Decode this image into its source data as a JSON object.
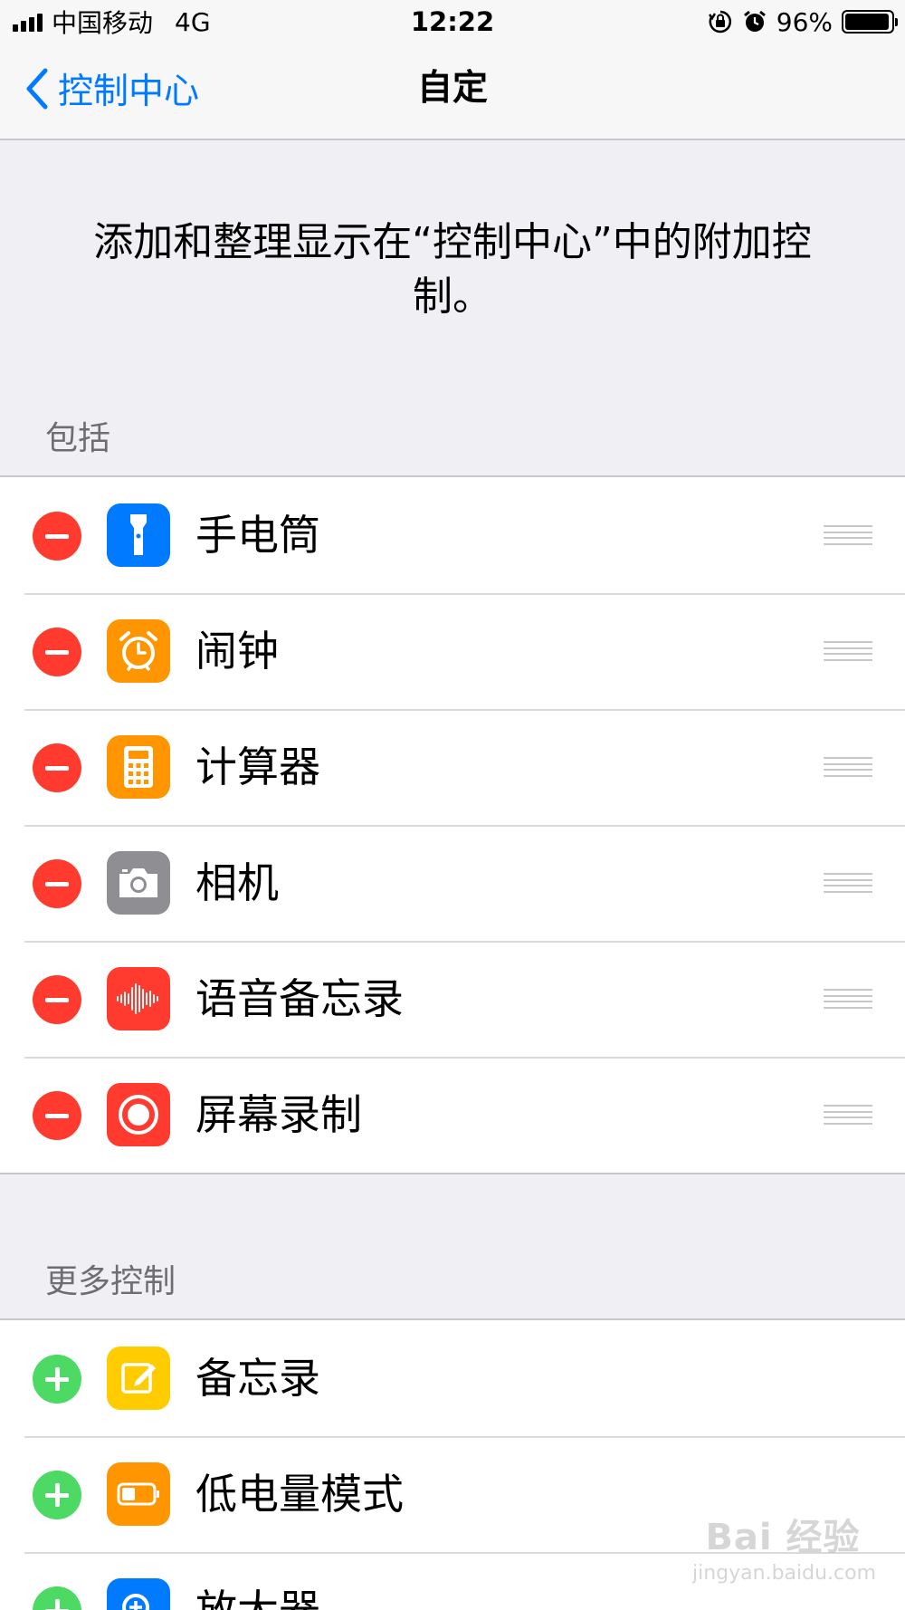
{
  "status_bar": {
    "carrier": "中国移动",
    "network": "4G",
    "time": "12:22",
    "battery_percent": "96%",
    "battery_level": 0.96
  },
  "nav": {
    "back_label": "控制中心",
    "title": "自定"
  },
  "description": "添加和整理显示在“控制中心”中的附加控制。",
  "included": {
    "header": "包括",
    "items": [
      {
        "label": "手电筒",
        "icon": "flashlight-icon",
        "color": "#007aff"
      },
      {
        "label": "闹钟",
        "icon": "alarm-clock-icon",
        "color": "#ff9500"
      },
      {
        "label": "计算器",
        "icon": "calculator-icon",
        "color": "#ff9500"
      },
      {
        "label": "相机",
        "icon": "camera-icon",
        "color": "#8e8e93"
      },
      {
        "label": "语音备忘录",
        "icon": "voice-memo-icon",
        "color": "#ff3b30"
      },
      {
        "label": "屏幕录制",
        "icon": "screen-record-icon",
        "color": "#ff3b30"
      }
    ]
  },
  "more": {
    "header": "更多控制",
    "items": [
      {
        "label": "备忘录",
        "icon": "notes-icon",
        "color": "#ffcc00"
      },
      {
        "label": "低电量模式",
        "icon": "low-power-icon",
        "color": "#ff9500"
      },
      {
        "label": "放大器",
        "icon": "magnifier-icon",
        "color": "#007aff"
      }
    ]
  },
  "watermark": {
    "brand": "Bai 经验",
    "url": "jingyan.baidu.com"
  },
  "colors": {
    "accent": "#007aff",
    "remove": "#ff3b30",
    "add": "#4cd964",
    "background": "#efeff4"
  }
}
